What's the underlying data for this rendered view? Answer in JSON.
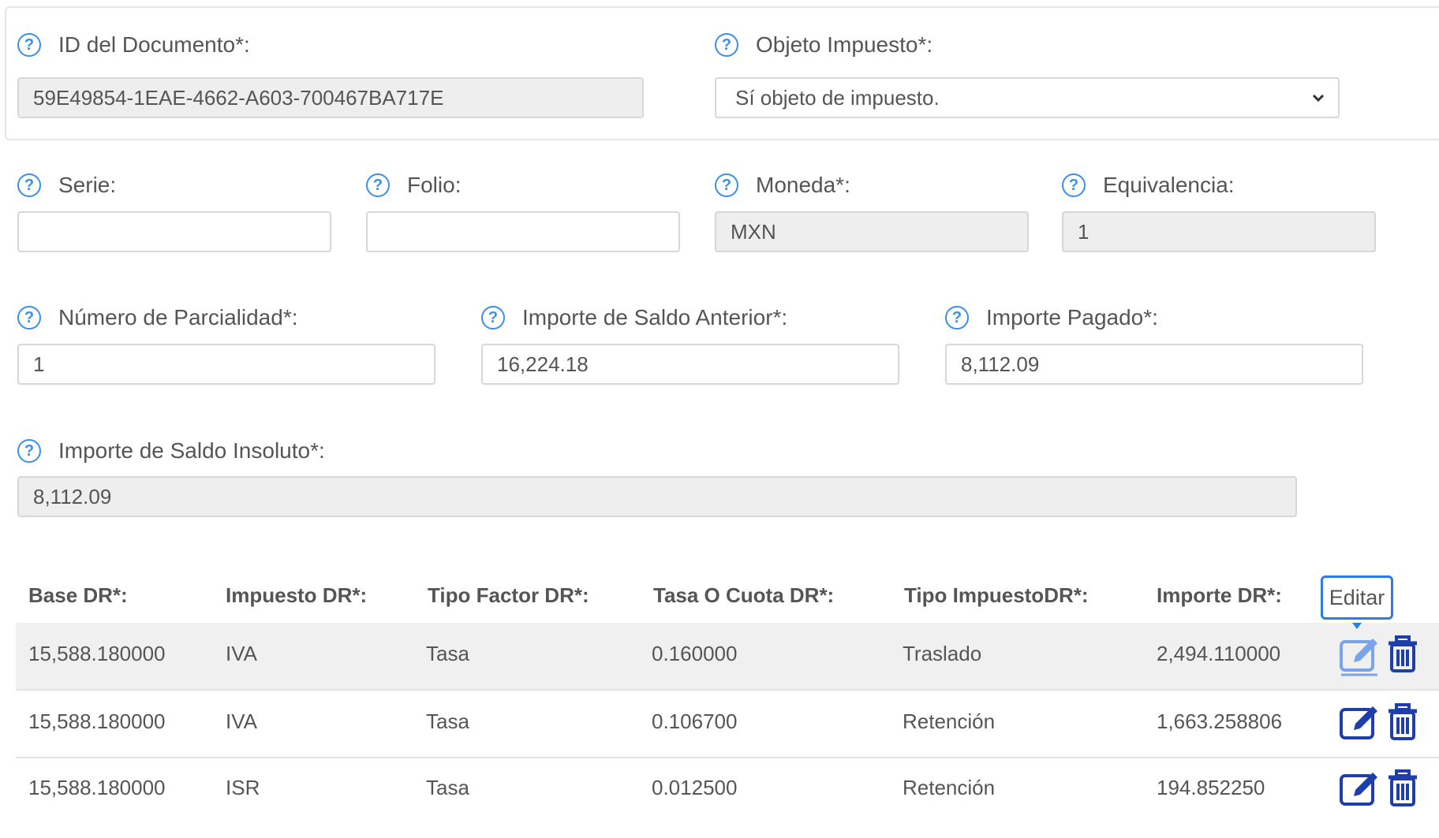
{
  "fields": {
    "id_documento": {
      "label": "ID del Documento*:",
      "value": "59E49854-1EAE-4662-A603-700467BA717E"
    },
    "objeto_impuesto": {
      "label": "Objeto Impuesto*:",
      "value": "Sí objeto de impuesto."
    },
    "serie": {
      "label": "Serie:",
      "value": ""
    },
    "folio": {
      "label": "Folio:",
      "value": ""
    },
    "moneda": {
      "label": "Moneda*:",
      "value": "MXN"
    },
    "equivalencia": {
      "label": "Equivalencia:",
      "value": "1"
    },
    "num_parcialidad": {
      "label": "Número de Parcialidad*:",
      "value": "1"
    },
    "saldo_anterior": {
      "label": "Importe de Saldo Anterior*:",
      "value": "16,224.18"
    },
    "importe_pagado": {
      "label": "Importe Pagado*:",
      "value": "8,112.09"
    },
    "saldo_insoluto": {
      "label": "Importe de Saldo Insoluto*:",
      "value": "8,112.09"
    }
  },
  "help_icon_glyph": "?",
  "table": {
    "headers": [
      "Base DR*:",
      "Impuesto DR*:",
      "Tipo Factor DR*:",
      "Tasa O Cuota DR*:",
      "Tipo ImpuestoDR*:",
      "Importe DR*:"
    ],
    "rows": [
      [
        "15,588.180000",
        "IVA",
        "Tasa",
        "0.160000",
        "Traslado",
        "2,494.110000"
      ],
      [
        "15,588.180000",
        "IVA",
        "Tasa",
        "0.106700",
        "Retención",
        "1,663.258806"
      ],
      [
        "15,588.180000",
        "ISR",
        "Tasa",
        "0.012500",
        "Retención",
        "194.852250"
      ]
    ],
    "edit_tooltip": "Editar"
  },
  "colors": {
    "help": "#3b8fe8",
    "action_icons": "#1f3fa8",
    "highlight_edit": "#5a8fe0"
  }
}
